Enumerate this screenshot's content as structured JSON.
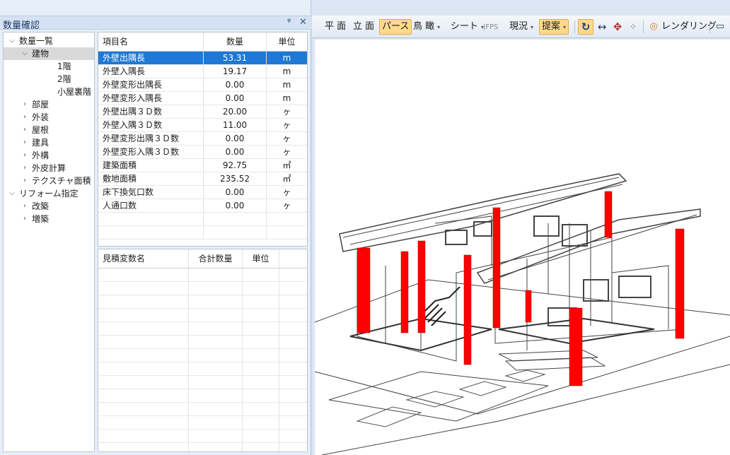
{
  "panel": {
    "title": "数量確認",
    "pin_glyph": "📌",
    "close_glyph": "✕"
  },
  "tree": [
    {
      "label": "数量一覧",
      "level": 0,
      "chevron": "down"
    },
    {
      "label": "建物",
      "level": 1,
      "chevron": "down",
      "selected": true
    },
    {
      "label": "1階",
      "level": 3,
      "chevron": ""
    },
    {
      "label": "2階",
      "level": 3,
      "chevron": ""
    },
    {
      "label": "小屋裏階",
      "level": 3,
      "chevron": ""
    },
    {
      "label": "部屋",
      "level": 1,
      "chevron": "right"
    },
    {
      "label": "外装",
      "level": 1,
      "chevron": "right"
    },
    {
      "label": "屋根",
      "level": 1,
      "chevron": "right"
    },
    {
      "label": "建具",
      "level": 1,
      "chevron": "right"
    },
    {
      "label": "外構",
      "level": 1,
      "chevron": "right"
    },
    {
      "label": "外皮計算",
      "level": 1,
      "chevron": "right"
    },
    {
      "label": "テクスチャ面積",
      "level": 1,
      "chevron": "right"
    },
    {
      "label": "リフォーム指定",
      "level": 0,
      "chevron": "down"
    },
    {
      "label": "改築",
      "level": 1,
      "chevron": "right"
    },
    {
      "label": "増築",
      "level": 1,
      "chevron": "right"
    }
  ],
  "quantity_table": {
    "headers": {
      "name": "項目名",
      "qty": "数量",
      "unit": "単位"
    },
    "rows": [
      {
        "name": "外壁出隅長",
        "qty": "53.31",
        "unit": "m",
        "selected": true
      },
      {
        "name": "外壁入隅長",
        "qty": "19.17",
        "unit": "m"
      },
      {
        "name": "外壁変形出隅長",
        "qty": "0.00",
        "unit": "m"
      },
      {
        "name": "外壁変形入隅長",
        "qty": "0.00",
        "unit": "m"
      },
      {
        "name": "外壁出隅３Ｄ数",
        "qty": "20.00",
        "unit": "ヶ"
      },
      {
        "name": "外壁入隅３Ｄ数",
        "qty": "11.00",
        "unit": "ヶ"
      },
      {
        "name": "外壁変形出隅３Ｄ数",
        "qty": "0.00",
        "unit": "ヶ"
      },
      {
        "name": "外壁変形入隅３Ｄ数",
        "qty": "0.00",
        "unit": "ヶ"
      },
      {
        "name": "建築面積",
        "qty": "92.75",
        "unit": "㎡"
      },
      {
        "name": "敷地面積",
        "qty": "235.52",
        "unit": "㎡"
      },
      {
        "name": "床下換気口数",
        "qty": "0.00",
        "unit": "ヶ"
      },
      {
        "name": "人通口数",
        "qty": "0.00",
        "unit": "ヶ"
      }
    ]
  },
  "estimate_table": {
    "headers": {
      "name": "見積変数名",
      "qty": "合計数量",
      "unit": "単位"
    }
  },
  "toolbar": {
    "plan": "平 面",
    "elevation": "立 面",
    "perspective": "パース",
    "birdseye": "鳥 瞰",
    "sheet": "シート",
    "fps": "FPS",
    "current": "現況",
    "proposal": "提案",
    "rendering": "レンダリング"
  },
  "icons": {
    "refresh": "refresh-icon",
    "pan_horizontal": "horizontal-arrows-icon",
    "move": "move-arrows-icon",
    "walk": "footsteps-icon",
    "render": "render-icon",
    "monitor": "monitor-icon"
  },
  "colors": {
    "accent": "#ffd98c",
    "selection": "#1e78d4",
    "highlight_column": "#ff0000"
  }
}
